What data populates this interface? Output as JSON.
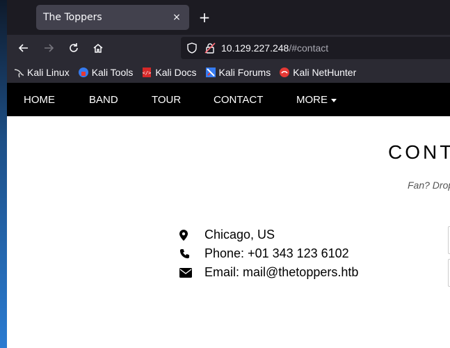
{
  "browser": {
    "tab": {
      "title": "The Toppers",
      "close": "×"
    },
    "newtab": "+",
    "url": {
      "host": "10.129.227.248",
      "path": "/#contact"
    },
    "bookmarks": [
      {
        "label": "Kali Linux",
        "icon": "kali-linux-icon"
      },
      {
        "label": "Kali Tools",
        "icon": "kali-tools-icon"
      },
      {
        "label": "Kali Docs",
        "icon": "kali-docs-icon"
      },
      {
        "label": "Kali Forums",
        "icon": "kali-forums-icon"
      },
      {
        "label": "Kali NetHunter",
        "icon": "kali-nethunter-icon"
      }
    ]
  },
  "site": {
    "nav": {
      "home": "HOME",
      "band": "BAND",
      "tour": "TOUR",
      "contact": "CONTACT",
      "more": "MORE"
    },
    "contact": {
      "title": "CONT",
      "subtitle": "Fan? Drop",
      "location": "Chicago, US",
      "phone": "Phone: +01 343 123 6102",
      "email": "Email: mail@thetoppers.htb"
    }
  },
  "colors": {
    "nav_bg": "#000000",
    "browser_bg": "#2b2a33",
    "tab_bg": "#42414d"
  }
}
